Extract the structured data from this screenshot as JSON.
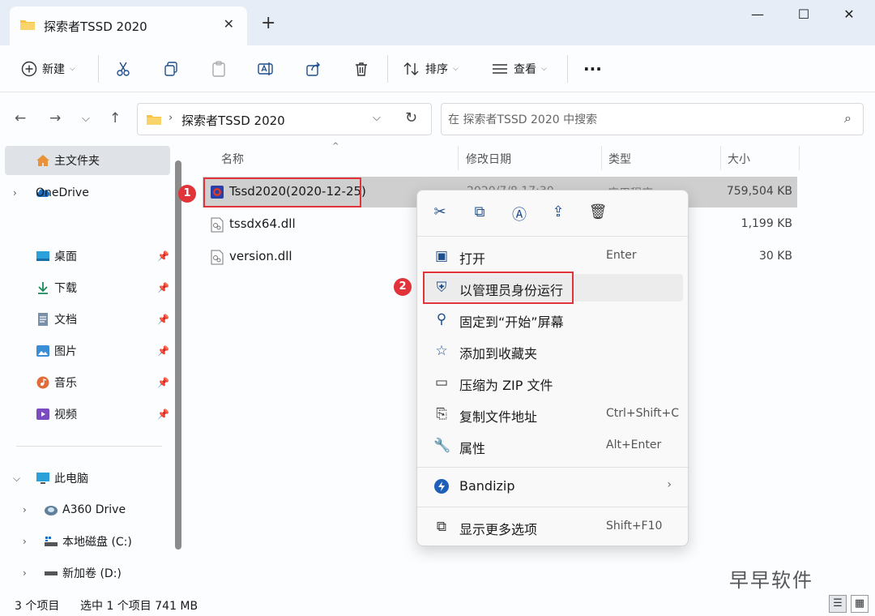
{
  "tab": {
    "title": "探索者TSSD 2020",
    "close": "✕",
    "new_tab": "+"
  },
  "window_controls": {
    "minimize": "—",
    "maximize": "☐",
    "close": "✕"
  },
  "toolbar": {
    "new_label": "新建",
    "sort_label": "排序",
    "view_label": "查看",
    "more": "···"
  },
  "address": {
    "path": "探索者TSSD 2020",
    "search_placeholder": "在 探索者TSSD 2020 中搜索"
  },
  "sidebar": {
    "home": "主文件夹",
    "onedrive": "OneDrive",
    "quick": [
      "桌面",
      "下载",
      "文档",
      "图片",
      "音乐",
      "视频"
    ],
    "this_pc": "此电脑",
    "drives": [
      "A360 Drive",
      "本地磁盘 (C:)",
      "新加卷 (D:)"
    ]
  },
  "columns": {
    "name": "名称",
    "modified": "修改日期",
    "type": "类型",
    "size": "大小"
  },
  "files": [
    {
      "name": "Tssd2020(2020-12-25)",
      "date": "2020/7/8 17:30",
      "type": "应用程序",
      "size": "759,504 KB"
    },
    {
      "name": "tssdx64.dll",
      "size": "1,199 KB"
    },
    {
      "name": "version.dll",
      "size": "30 KB"
    }
  ],
  "context_menu": {
    "open": "打开",
    "open_sc": "Enter",
    "run_admin": "以管理员身份运行",
    "pin_start": "固定到“开始”屏幕",
    "add_fav": "添加到收藏夹",
    "zip": "压缩为 ZIP 文件",
    "copy_path": "复制文件地址",
    "copy_path_sc": "Ctrl+Shift+C",
    "properties": "属性",
    "properties_sc": "Alt+Enter",
    "bandizip": "Bandizip",
    "more_options": "显示更多选项",
    "more_options_sc": "Shift+F10"
  },
  "steps": {
    "one": "1",
    "two": "2"
  },
  "status": {
    "count": "3 个项目",
    "selected": "选中 1 个项目  741 MB"
  },
  "watermark": "早早软件",
  "colors": {
    "highlight_red": "#e0333a",
    "accent_blue": "#1f4e8c",
    "selected_row": "#cfcfcf"
  }
}
